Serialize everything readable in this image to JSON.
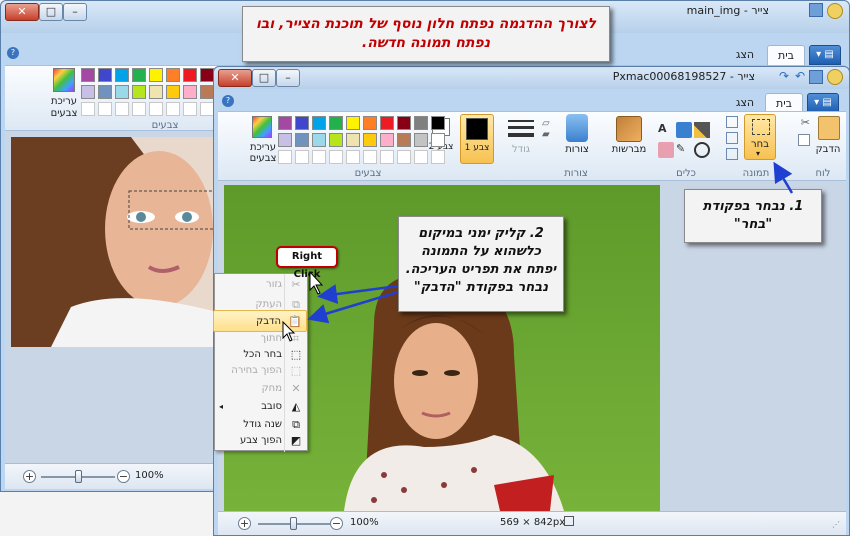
{
  "top_callout": {
    "text": "לצורך ההדגמה נפתח חלון נוסף של תוכנת הצייר, ובו נפתח תמונה חדשה."
  },
  "callout1": {
    "text": "1. נבחר בפקודת \"בחר\""
  },
  "callout2": {
    "text": "2. קליק ימני במיקום כלשהוא על התמונה יפתח את תפריט העריכה. נבחר בפקודת \"הדבק\""
  },
  "right_click_label": "Right Click",
  "back_window": {
    "title": "main_img - צייר",
    "tabs": {
      "home": "בית",
      "view": "הצג"
    },
    "group_colors": "צבעים",
    "edit_colors": "עריכת צבעים",
    "zoom": "100%",
    "zoom_minus": "−",
    "zoom_plus": "+"
  },
  "front_window": {
    "title": "Pxmac00068198527 - צייר",
    "tabs": {
      "home": "בית",
      "view": "הצג"
    },
    "groups": {
      "clipboard": "לוח",
      "image": "תמונה",
      "tools": "כלים",
      "shapes": "צורות",
      "colors": "צבעים"
    },
    "buttons": {
      "paste": "הדבק",
      "select": "בחר",
      "brushes": "מברשות",
      "shapes": "צורות",
      "size": "גודל",
      "color1": "צבע 1",
      "color2": "צבע 2",
      "edit_colors": "עריכת צבעים"
    },
    "dimensions": "569 × 842px",
    "zoom": "100%",
    "zoom_minus": "−",
    "zoom_plus": "+"
  },
  "context_menu": {
    "items": [
      {
        "label": "גזור",
        "icon": "scissors-icon",
        "disabled": true
      },
      {
        "label": "העתק",
        "icon": "copy-icon",
        "disabled": true
      },
      {
        "label": "הדבק",
        "icon": "paste-icon",
        "disabled": false,
        "highlighted": true
      },
      {
        "label": "חתוך",
        "icon": "crop-icon",
        "disabled": true
      },
      {
        "label": "בחר הכל",
        "icon": "select-all-icon",
        "disabled": false
      },
      {
        "label": "הפוך בחירה",
        "icon": "invert-selection-icon",
        "disabled": true
      },
      {
        "label": "מחק",
        "icon": "delete-icon",
        "disabled": true
      },
      {
        "label": "סובב",
        "icon": "rotate-icon",
        "disabled": false,
        "submenu": true
      },
      {
        "label": "שנה גודל",
        "icon": "resize-icon",
        "disabled": false
      },
      {
        "label": "הפוך צבע",
        "icon": "invert-color-icon",
        "disabled": false
      }
    ]
  },
  "palette": [
    "#000000",
    "#7f7f7f",
    "#880015",
    "#ed1c24",
    "#ff7f27",
    "#fff200",
    "#22b14c",
    "#00a2e8",
    "#3f48cc",
    "#a349a4",
    "#ffffff",
    "#c3c3c3",
    "#b97a57",
    "#ffaec9",
    "#ffc90e",
    "#efe4b0",
    "#b5e61d",
    "#99d9ea",
    "#7092be",
    "#c8bfe7"
  ],
  "accent_colors": {
    "title_red": "#c00000",
    "arrow_blue": "#1f3fd0",
    "highlight": "#f6c453",
    "file_blue": "#2a6cc0"
  }
}
